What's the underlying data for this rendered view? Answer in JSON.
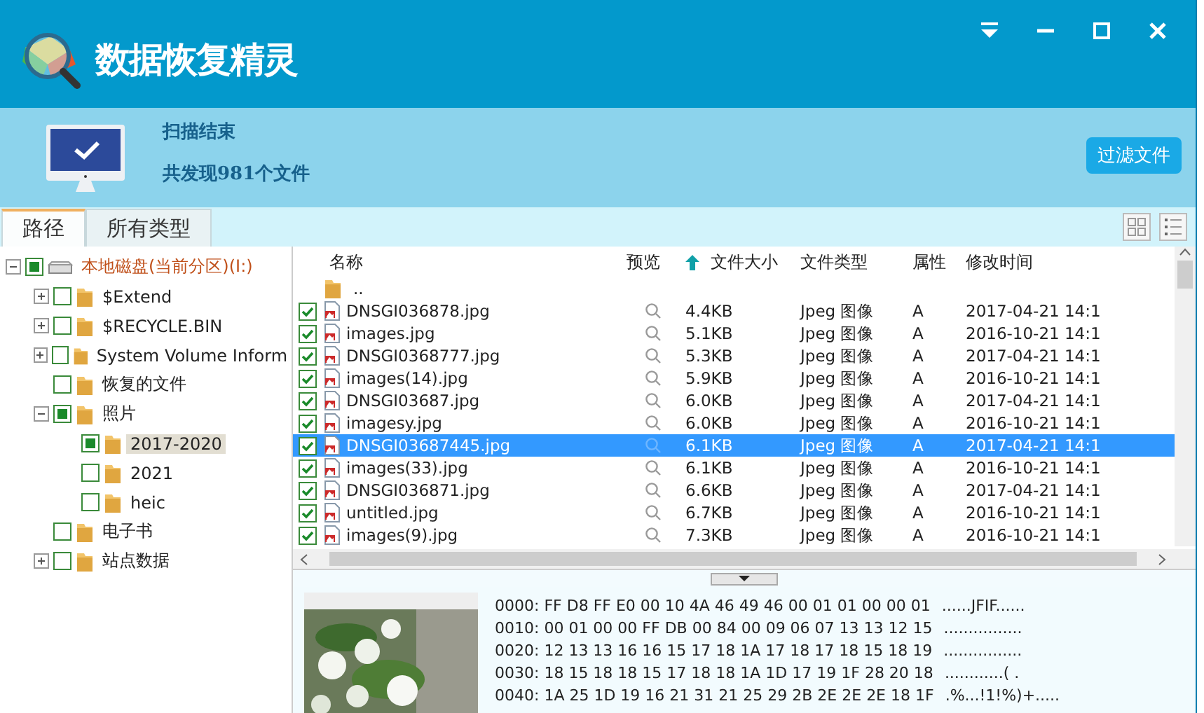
{
  "app": {
    "title": "数据恢复精灵"
  },
  "status": {
    "title": "扫描结束",
    "summary": "共发现981个文件",
    "filter_button": "过滤文件"
  },
  "tabs": [
    {
      "label": "路径",
      "selected": true
    },
    {
      "label": "所有类型",
      "selected": false
    }
  ],
  "tree": {
    "label": "本地磁盘(当前分区)(I:)",
    "checked": true,
    "expanded": true,
    "selected": false,
    "children": [
      {
        "label": "$Extend",
        "checked": false,
        "expanded": false,
        "selected": false
      },
      {
        "label": "$RECYCLE.BIN",
        "checked": false,
        "expanded": false,
        "selected": false
      },
      {
        "label": "System Volume Inform",
        "checked": false,
        "expanded": false,
        "selected": false
      },
      {
        "label": "恢复的文件",
        "checked": false,
        "selected": false
      },
      {
        "label": "照片",
        "checked": true,
        "expanded": true,
        "selected": false,
        "children": [
          {
            "label": "2017-2020",
            "checked": true,
            "selected": true
          },
          {
            "label": "2021",
            "checked": false,
            "selected": false
          },
          {
            "label": "heic",
            "checked": false,
            "selected": false
          }
        ]
      },
      {
        "label": "电子书",
        "checked": false,
        "selected": false
      },
      {
        "label": "站点数据",
        "checked": false,
        "expanded": false,
        "selected": false
      }
    ]
  },
  "table": {
    "columns": [
      {
        "label": "名称",
        "sorted": false
      },
      {
        "label": "预览",
        "sorted": false
      },
      {
        "label": "文件大小",
        "sorted": true
      },
      {
        "label": "文件类型",
        "sorted": false
      },
      {
        "label": "属性",
        "sorted": false
      },
      {
        "label": "修改时间",
        "sorted": false
      }
    ],
    "parent_row": "..",
    "rows": [
      {
        "name": "DNSGI036878.jpg",
        "size": "4.4KB",
        "type": "Jpeg 图像",
        "attr": "A",
        "modified": "2017-04-21 14:1",
        "checked": true,
        "selected": false
      },
      {
        "name": "images.jpg",
        "size": "5.1KB",
        "type": "Jpeg 图像",
        "attr": "A",
        "modified": "2016-10-21 14:1",
        "checked": true,
        "selected": false
      },
      {
        "name": "DNSGI0368777.jpg",
        "size": "5.3KB",
        "type": "Jpeg 图像",
        "attr": "A",
        "modified": "2017-04-21 14:1",
        "checked": true,
        "selected": false
      },
      {
        "name": "images(14).jpg",
        "size": "5.9KB",
        "type": "Jpeg 图像",
        "attr": "A",
        "modified": "2016-10-21 14:1",
        "checked": true,
        "selected": false
      },
      {
        "name": "DNSGI03687.jpg",
        "size": "6.0KB",
        "type": "Jpeg 图像",
        "attr": "A",
        "modified": "2017-04-21 14:1",
        "checked": true,
        "selected": false
      },
      {
        "name": "imagesy.jpg",
        "size": "6.0KB",
        "type": "Jpeg 图像",
        "attr": "A",
        "modified": "2016-10-21 14:1",
        "checked": true,
        "selected": false
      },
      {
        "name": "DNSGI03687445.jpg",
        "size": "6.1KB",
        "type": "Jpeg 图像",
        "attr": "A",
        "modified": "2017-04-21 14:1",
        "checked": true,
        "selected": true
      },
      {
        "name": "images(33).jpg",
        "size": "6.1KB",
        "type": "Jpeg 图像",
        "attr": "A",
        "modified": "2016-10-21 14:1",
        "checked": true,
        "selected": false
      },
      {
        "name": "DNSGI036871.jpg",
        "size": "6.6KB",
        "type": "Jpeg 图像",
        "attr": "A",
        "modified": "2017-04-21 14:1",
        "checked": true,
        "selected": false
      },
      {
        "name": "untitled.jpg",
        "size": "6.7KB",
        "type": "Jpeg 图像",
        "attr": "A",
        "modified": "2016-10-21 14:1",
        "checked": true,
        "selected": false
      },
      {
        "name": "images(9).jpg",
        "size": "7.3KB",
        "type": "Jpeg 图像",
        "attr": "A",
        "modified": "2016-10-21 14:1",
        "checked": true,
        "selected": false
      }
    ]
  },
  "preview": {
    "hex_lines": [
      {
        "offset": "0000:",
        "hex": "FF D8 FF E0 00 10 4A 46 49 46 00 01 01 00 00 01",
        "ascii": "......JFIF......"
      },
      {
        "offset": "0010:",
        "hex": "00 01 00 00 FF DB 00 84 00 09 06 07 13 13 12 15",
        "ascii": "................"
      },
      {
        "offset": "0020:",
        "hex": "12 13 13 16 16 15 17 18 1A 17 18 17 18 15 18 19",
        "ascii": "................"
      },
      {
        "offset": "0030:",
        "hex": "18 15 18 18 15 17 18 18 1A 1D 17 19 1F 28 20 18",
        "ascii": "............( ."
      },
      {
        "offset": "0040:",
        "hex": "1A 25 1D 19 16 21 31 21 25 29 2B 2E 2E 2E 18 1F",
        "ascii": ".%...!1!%)+....."
      }
    ]
  }
}
